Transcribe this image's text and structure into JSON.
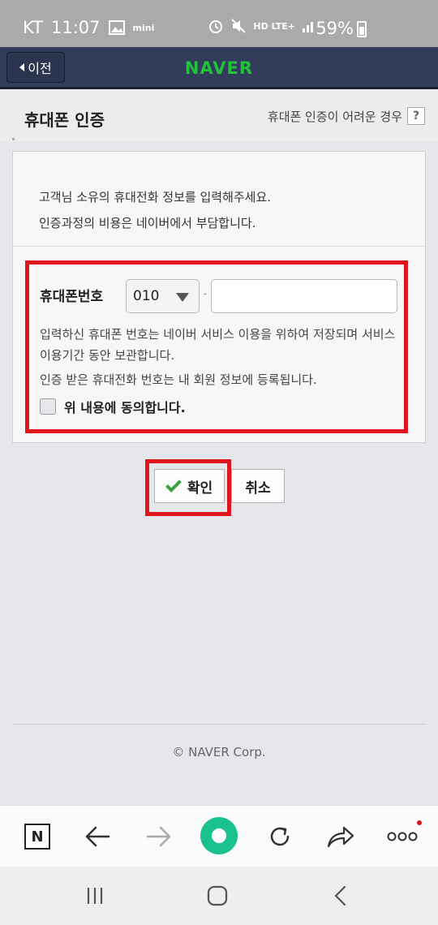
{
  "status_bar": {
    "carrier": "KT",
    "time": "11:07",
    "mini_label": "mini",
    "network": "HD LTE+",
    "battery": "59%"
  },
  "header": {
    "back_label": "이전",
    "logo": "NAVER"
  },
  "page": {
    "title": "휴대폰 인증",
    "help_link": "휴대폰 인증이 어려운 경우",
    "help_icon": "?"
  },
  "intro": {
    "line1": "고객님 소유의 휴대전화 정보를 입력해주세요.",
    "line2": "인증과정의 비용은 네이버에서 부담합니다."
  },
  "form": {
    "phone_label": "휴대폰번호",
    "prefix_value": "010",
    "separator": "-",
    "phone_value": "",
    "notice1": "입력하신 휴대폰 번호는 네이버 서비스 이용을 위하여 저장되며 서비스 이용기간 동안 보관합니다.",
    "notice2": "인증 받은 휴대전화 번호는 내 회원 정보에 등록됩니다.",
    "agree_label": "위 내용에 동의합니다.",
    "agree_checked": false
  },
  "buttons": {
    "confirm": "확인",
    "cancel": "취소"
  },
  "footer": {
    "copyright": "© NAVER Corp."
  },
  "browser_toolbar": {
    "n_icon": "N",
    "more": "ooo"
  },
  "colors": {
    "header_bg": "#323d5c",
    "logo_green": "#22c33a",
    "highlight_red": "#e0151e",
    "check_green": "#3aa13e",
    "green_button": "#19c28f"
  }
}
